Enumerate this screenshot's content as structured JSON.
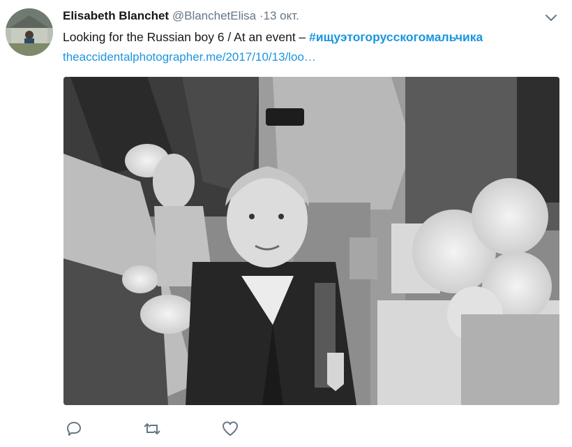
{
  "tweet": {
    "author_name": "Elisabeth Blanchet",
    "author_handle": "@BlanchetElisa",
    "separator": "·",
    "date": "13 окт.",
    "text_prefix": "Looking for the Russian boy 6 / At an event – ",
    "hashtag": "#ищуэтогорусскогомальчика",
    "link_text": "theaccidentalphotographer.me/2017/10/13/loo…"
  },
  "icons": {
    "menu": "chevron-down-icon",
    "reply": "reply-icon",
    "retweet": "retweet-icon",
    "like": "heart-icon"
  },
  "colors": {
    "accent": "#1b95e0",
    "muted": "#657786",
    "text": "#14171a"
  }
}
